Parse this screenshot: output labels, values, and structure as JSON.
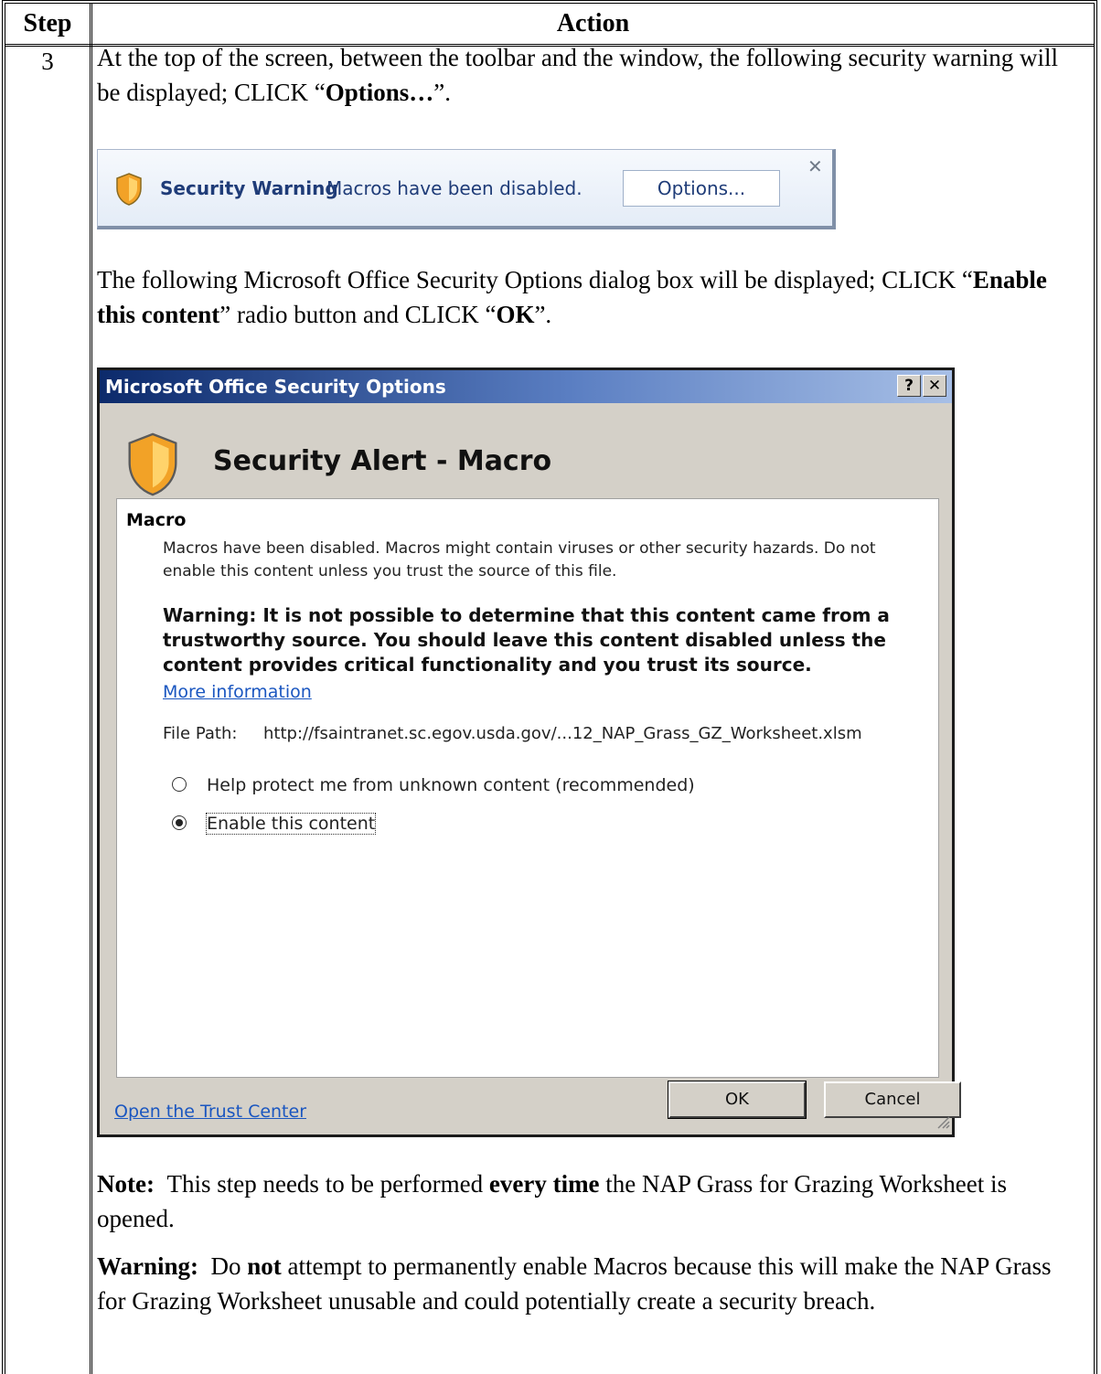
{
  "table": {
    "header_step": "Step",
    "header_action": "Action",
    "step_number": "3"
  },
  "step": {
    "intro_before": "At the top of the screen, between the toolbar and the window, the following security warning will be displayed; CLICK “",
    "intro_bold": "Options…",
    "intro_after": "”.",
    "dialog_intro_before": "The following Microsoft Office Security Options dialog box will be displayed; CLICK “",
    "dialog_intro_bold1": "Enable this content",
    "dialog_intro_mid": "” radio button and CLICK “",
    "dialog_intro_bold2": "OK",
    "dialog_intro_after": "”."
  },
  "security_bar": {
    "title": "Security Warning",
    "message": "Macros have been disabled.",
    "options_button": "Options...",
    "close_glyph": "✕",
    "shield_color": "#f0a020"
  },
  "dialog": {
    "title": "Microsoft Office Security Options",
    "help_glyph": "?",
    "close_glyph": "✕",
    "heading": "Security Alert - Macro",
    "section_title": "Macro",
    "description": "Macros have been disabled. Macros might contain viruses or other security hazards. Do not enable this content unless you trust the source of this file.",
    "warning": "Warning: It is not possible to determine that this content came from a trustworthy source. You should leave this content disabled unless the content provides critical functionality and you trust its source.",
    "more_info": "More information",
    "file_path_label": "File Path:",
    "file_path_value": "http://fsaintranet.sc.egov.usda.gov/...12_NAP_Grass_GZ_Worksheet.xlsm",
    "radio_options": [
      {
        "label": "Help protect me from unknown content (recommended)",
        "selected": false
      },
      {
        "label": "Enable this content",
        "selected": true
      }
    ],
    "trust_center_link": "Open the Trust Center",
    "ok_button": "OK",
    "cancel_button": "Cancel"
  },
  "notes": {
    "note_label": "Note:",
    "note_before": "This step needs to be performed ",
    "note_bold": "every time",
    "note_after": " the NAP Grass for Grazing Worksheet is opened.",
    "warning_label": "Warning:",
    "warning_before": "Do ",
    "warning_bold": "not",
    "warning_after": " attempt to permanently enable Macros because this will make the NAP Grass for Grazing Worksheet unusable and could potentially create a security breach."
  }
}
